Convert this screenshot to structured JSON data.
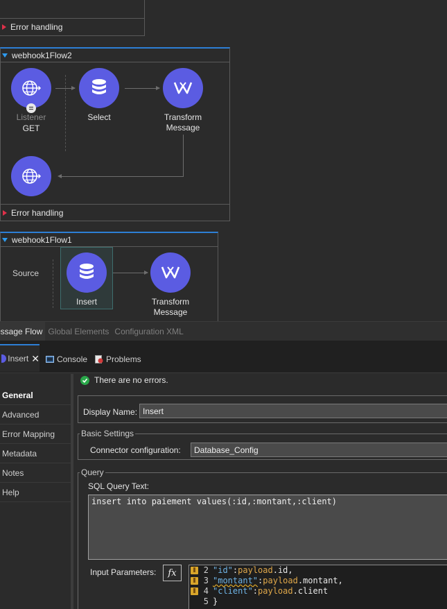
{
  "canvas": {
    "top_flow": {
      "error_handling": "Error handling"
    },
    "flow2": {
      "title": "webhook1Flow2",
      "nodes": [
        {
          "label": "Listener",
          "sublabel": "GET"
        },
        {
          "label": "Select"
        },
        {
          "label_line1": "Transform",
          "label_line2": "Message"
        }
      ],
      "error_handling": "Error handling"
    },
    "flow1": {
      "title": "webhook1Flow1",
      "source": "Source",
      "nodes": [
        {
          "label": "Insert"
        },
        {
          "label_line1": "Transform",
          "label_line2": "Message"
        }
      ]
    }
  },
  "editor_tabs": [
    "essage Flow",
    "Global Elements",
    "Configuration XML"
  ],
  "views": {
    "insert": "Insert",
    "console": "Console",
    "problems": "Problems"
  },
  "sidebar": {
    "items": [
      "General",
      "Advanced",
      "Error Mapping",
      "Metadata",
      "Notes",
      "Help"
    ]
  },
  "properties": {
    "status": "There are no errors.",
    "display_name_label": "Display Name:",
    "display_name_value": "Insert",
    "basic_settings": "Basic Settings",
    "connector_label": "Connector configuration:",
    "connector_value": "Database_Config",
    "query_group": "Query",
    "sql_label": "SQL Query Text:",
    "sql_value": "insert into paiement values(:id,:montant,:client)",
    "input_params_label": "Input Parameters:",
    "fx": "fx",
    "code_lines": [
      {
        "num": "2",
        "key": "\"id\"",
        "sep": ":",
        "obj": "payload",
        "rest": ".id,"
      },
      {
        "num": "3",
        "key": "\"montant\"",
        "sep": ":",
        "obj": "payload",
        "rest": ".montant,"
      },
      {
        "num": "4",
        "key": "\"client\"",
        "sep": ":",
        "obj": "payload",
        "rest": ".client"
      },
      {
        "num": "5",
        "key": "",
        "sep": "}",
        "obj": "",
        "rest": ""
      }
    ]
  },
  "colors": {
    "node": "#5b5ce2",
    "accent": "#2d7fd6",
    "error_marker": "#e0304a",
    "ok": "#2aa84a"
  }
}
